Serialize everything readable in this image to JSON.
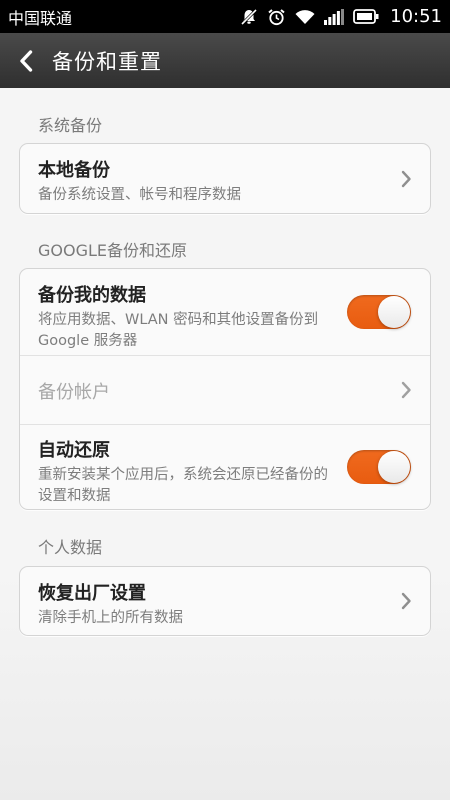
{
  "status_bar": {
    "carrier": "中国联通",
    "time": "10:51"
  },
  "header": {
    "back_icon": "chevron-left-icon",
    "title": "备份和重置"
  },
  "sections": [
    {
      "label": "系统备份",
      "items": [
        {
          "title": "本地备份",
          "subtitle": "备份系统设置、帐号和程序数据"
        }
      ]
    },
    {
      "label": "GOOGLE备份和还原",
      "items": [
        {
          "title": "备份我的数据",
          "subtitle": "将应用数据、WLAN 密码和其他设置备份到 Google 服务器",
          "toggle": true
        },
        {
          "title": "备份帐户",
          "disabled": true
        },
        {
          "title": "自动还原",
          "subtitle": "重新安装某个应用后，系统会还原已经备份的设置和数据",
          "toggle": true
        }
      ]
    },
    {
      "label": "个人数据",
      "items": [
        {
          "title": "恢复出厂设置",
          "subtitle": "清除手机上的所有数据"
        }
      ]
    }
  ],
  "colors": {
    "toggle_on": "#e8621a",
    "header_bg": "#3a3a3a",
    "page_bg": "#f5f5f5"
  }
}
